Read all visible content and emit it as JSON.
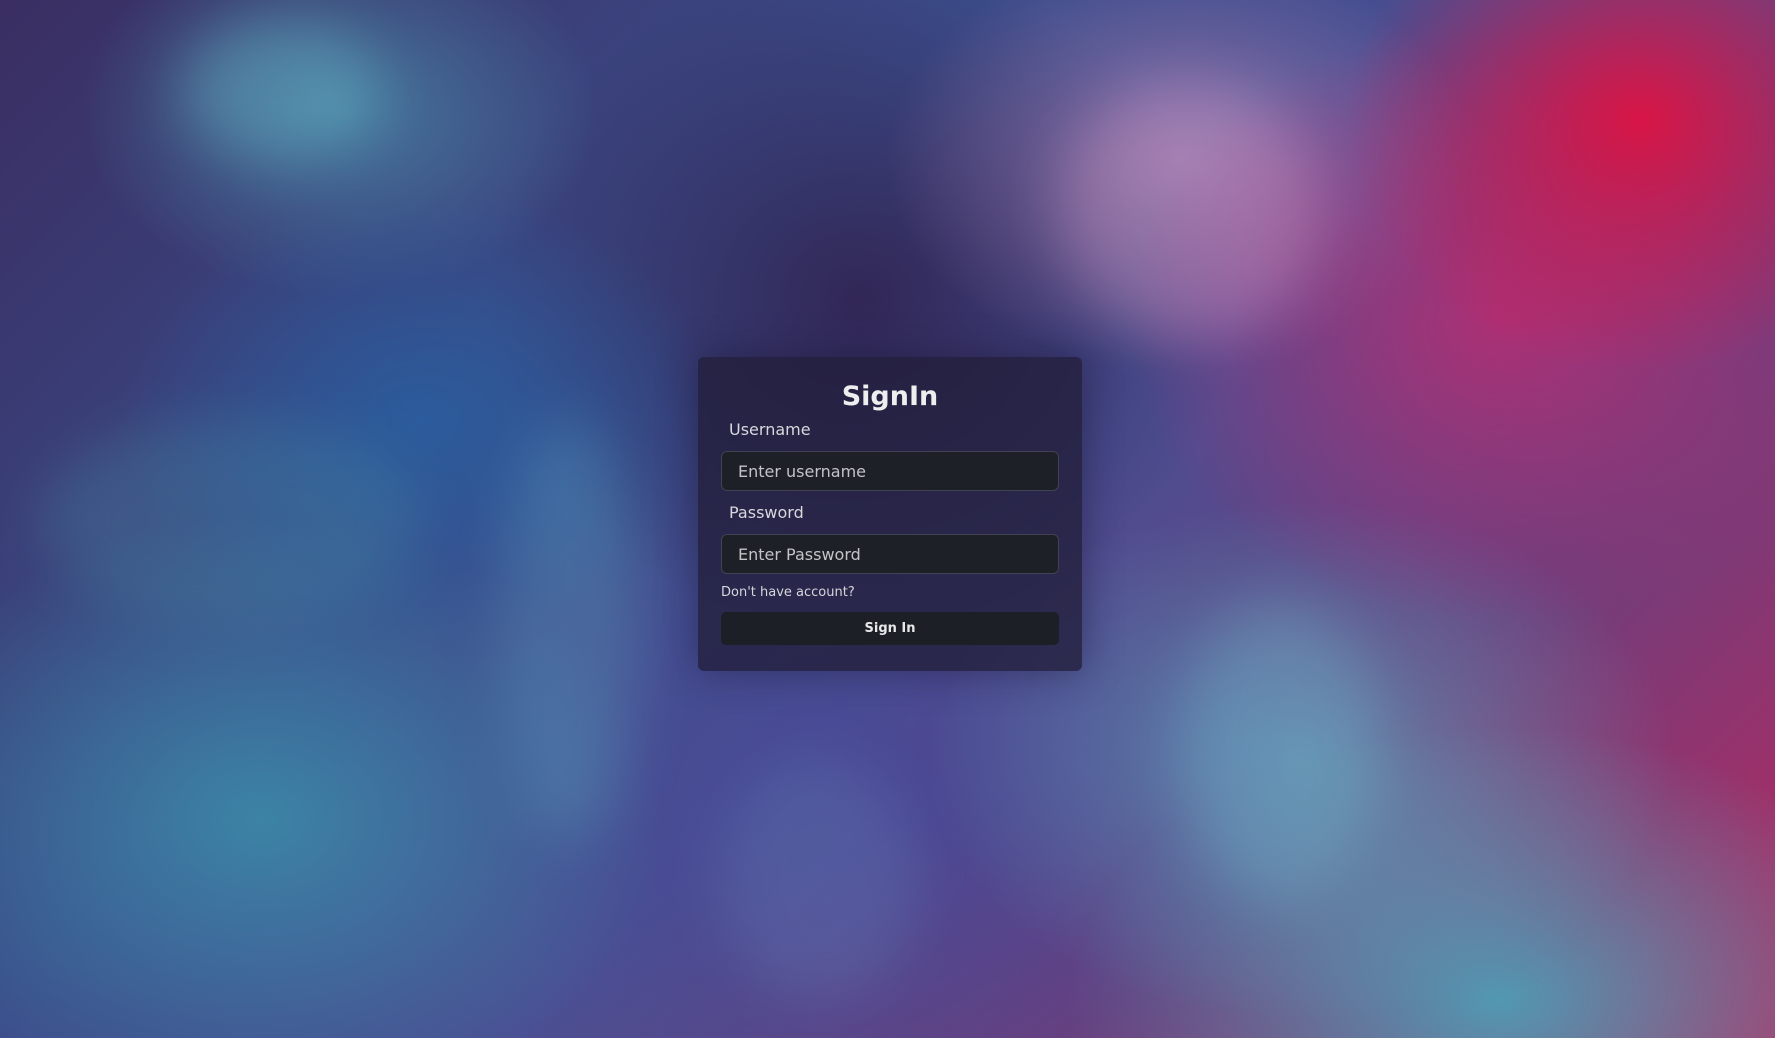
{
  "signin": {
    "title": "SignIn",
    "username_label": "Username",
    "username_placeholder": "Enter username",
    "username_value": "",
    "password_label": "Password",
    "password_placeholder": "Enter Password",
    "password_value": "",
    "signup_link": "Don't have account?",
    "submit_label": "Sign In"
  },
  "colors": {
    "card_background": "#211e3a",
    "input_background": "#1d2027",
    "button_background": "#1c1f26",
    "text_primary": "#eeeeee"
  }
}
